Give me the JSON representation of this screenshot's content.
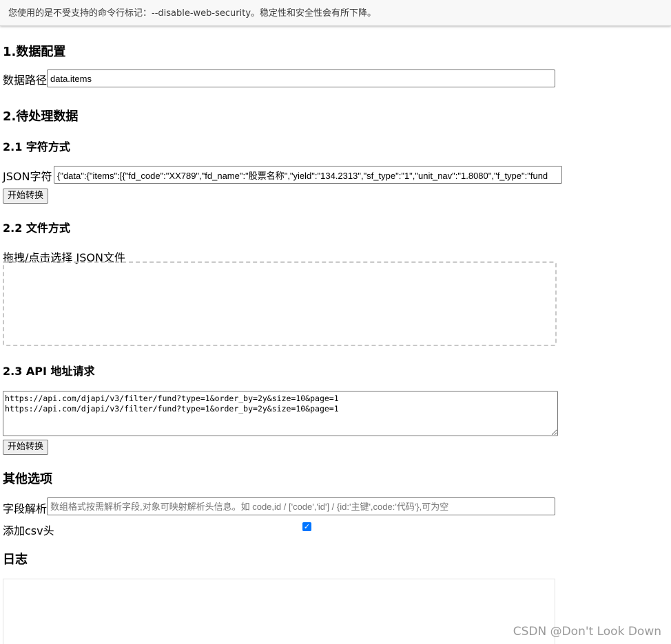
{
  "infobar": {
    "message": "您使用的是不受支持的命令行标记：--disable-web-security。稳定性和安全性会有所下降。"
  },
  "sections": {
    "data_config": {
      "title": "1.数据配置",
      "path_label": "数据路径",
      "path_value": "data.items"
    },
    "pending_data": {
      "title": "2.待处理数据",
      "string_mode": {
        "title": "2.1 字符方式",
        "json_label": "JSON字符",
        "json_value": "{\"data\":{\"items\":[{\"fd_code\":\"XX789\",\"fd_name\":\"股票名称\",\"yield\":\"134.2313\",\"sf_type\":\"1\",\"unit_nav\":\"1.8080\",\"f_type\":\"fund",
        "convert_button": "开始转换"
      },
      "file_mode": {
        "title": "2.2 文件方式",
        "drop_label": "拖拽/点击选择 JSON文件"
      },
      "api_mode": {
        "title": "2.3 API 地址请求",
        "urls": "https://api.com/djapi/v3/filter/fund?type=1&order_by=2y&size=10&page=1\nhttps://api.com/djapi/v3/filter/fund?type=1&order_by=2y&size=10&page=1",
        "convert_button": "开始转换"
      }
    },
    "other_options": {
      "title": "其他选项",
      "field_label": "字段解析",
      "field_placeholder": "数组格式按需解析字段,对象可映射解析头信息。如 code,id / ['code','id'] / {id:'主键',code:'代码'},可为空",
      "csv_header_label": "添加csv头",
      "csv_header_checked": true
    },
    "log": {
      "title": "日志"
    }
  },
  "watermark": "CSDN @Don't Look Down",
  "colors": {
    "checkbox_accent": "#0075ff",
    "infobar_bg": "#f8f8f8"
  }
}
